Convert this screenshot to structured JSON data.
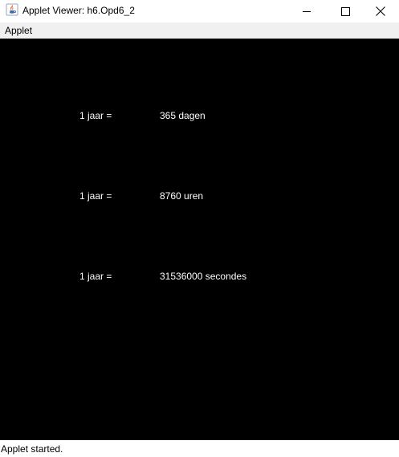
{
  "window": {
    "title": "Applet Viewer: h6.Opd6_2",
    "app_icon": "java-coffee-cup-icon",
    "controls": [
      "minimize-icon",
      "maximize-icon",
      "close-icon"
    ]
  },
  "menubar": {
    "items": [
      "Applet"
    ]
  },
  "applet": {
    "background": "#000000",
    "text_color": "#ffffff",
    "rows": [
      {
        "label": "1 jaar =",
        "value": "365 dagen"
      },
      {
        "label": "1 jaar =",
        "value": "8760 uren"
      },
      {
        "label": "1 jaar =",
        "value": "31536000 secondes"
      }
    ]
  },
  "status": {
    "text": "Applet started."
  }
}
